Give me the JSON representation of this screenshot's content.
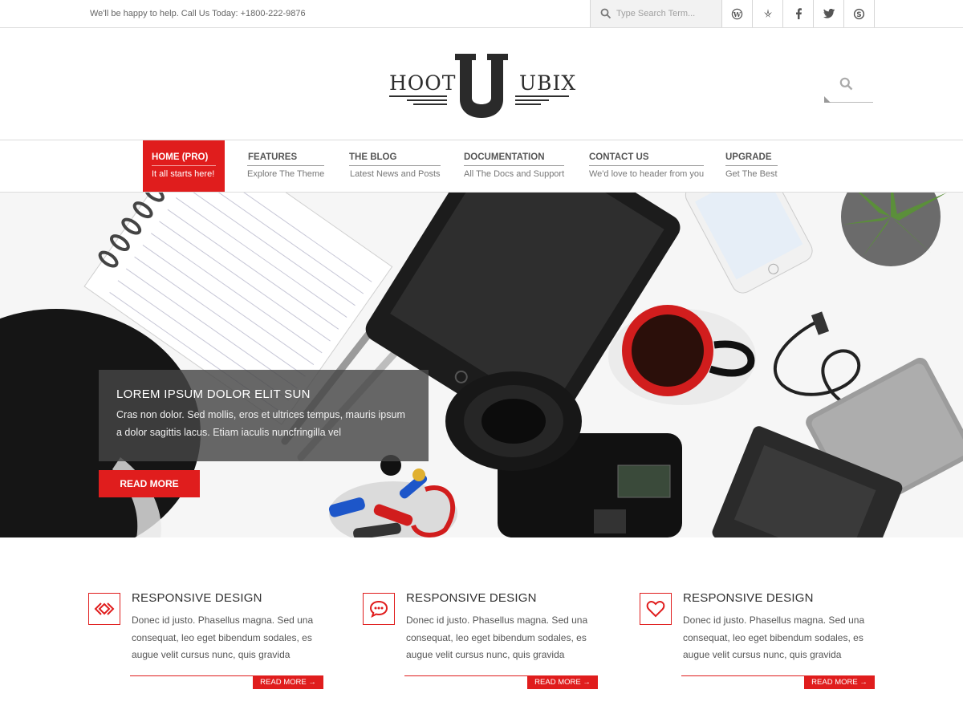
{
  "topbar": {
    "help_text": "We'll be happy to help. Call Us Today: +1800-222-9876",
    "search_placeholder": "Type Search Term...",
    "social_icons": [
      "wordpress-icon",
      "yelp-icon",
      "facebook-icon",
      "twitter-icon",
      "skype-icon"
    ]
  },
  "logo": {
    "left_word": "HOOT",
    "center_letter": "U",
    "right_word": "UBIX"
  },
  "nav": {
    "items": [
      {
        "title": "HOME (PRO)",
        "desc": "It all starts here!"
      },
      {
        "title": "FEATURES",
        "desc": "Explore The Theme"
      },
      {
        "title": "THE BLOG",
        "desc": "Latest News and Posts"
      },
      {
        "title": "DOCUMENTATION",
        "desc": "All The Docs and Support"
      },
      {
        "title": "CONTACT US",
        "desc": "We'd love to header from you"
      },
      {
        "title": "UPGRADE",
        "desc": "Get The Best"
      }
    ]
  },
  "hero": {
    "title": "LOREM IPSUM DOLOR ELIT SUN",
    "body": "Cras non dolor. Sed mollis, eros et ultrices tempus, mauris ipsum a dolor sagittis lacus. Etiam iaculis nuncfringilla vel",
    "button": "READ MORE"
  },
  "features": [
    {
      "icon": "diamond-arrows-icon",
      "title": "RESPONSIVE DESIGN",
      "body": "Donec id justo. Phasellus magna. Sed una consequat, leo eget bibendum sodales, es augue velit cursus nunc, quis gravida",
      "button": "READ MORE →"
    },
    {
      "icon": "chat-bubble-icon",
      "title": "RESPONSIVE DESIGN",
      "body": "Donec id justo. Phasellus magna. Sed una consequat, leo eget bibendum sodales, es augue velit cursus nunc, quis gravida",
      "button": "READ MORE →"
    },
    {
      "icon": "heart-icon",
      "title": "RESPONSIVE DESIGN",
      "body": "Donec id justo. Phasellus magna. Sed una consequat, leo eget bibendum sodales, es augue velit cursus nunc, quis gravida",
      "button": "READ MORE →"
    }
  ],
  "colors": {
    "accent": "#e01d1d",
    "text": "#333333",
    "nav_text": "#555555"
  }
}
